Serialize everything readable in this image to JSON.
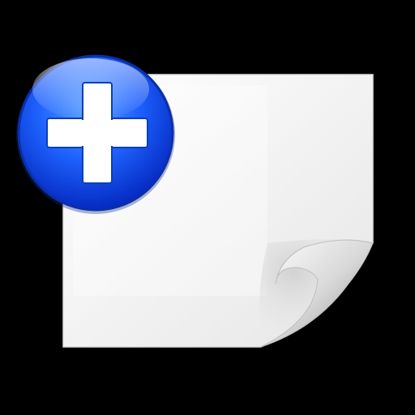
{
  "icon": {
    "name": "new-document-icon",
    "badge": "plus-badge-icon"
  },
  "colors": {
    "background": "#000000",
    "page": "#f3f3f3",
    "page_edge": "#ffffff",
    "badge_blue": "#1f63ff",
    "badge_dark": "#0022b8",
    "plus": "#ffffff"
  }
}
